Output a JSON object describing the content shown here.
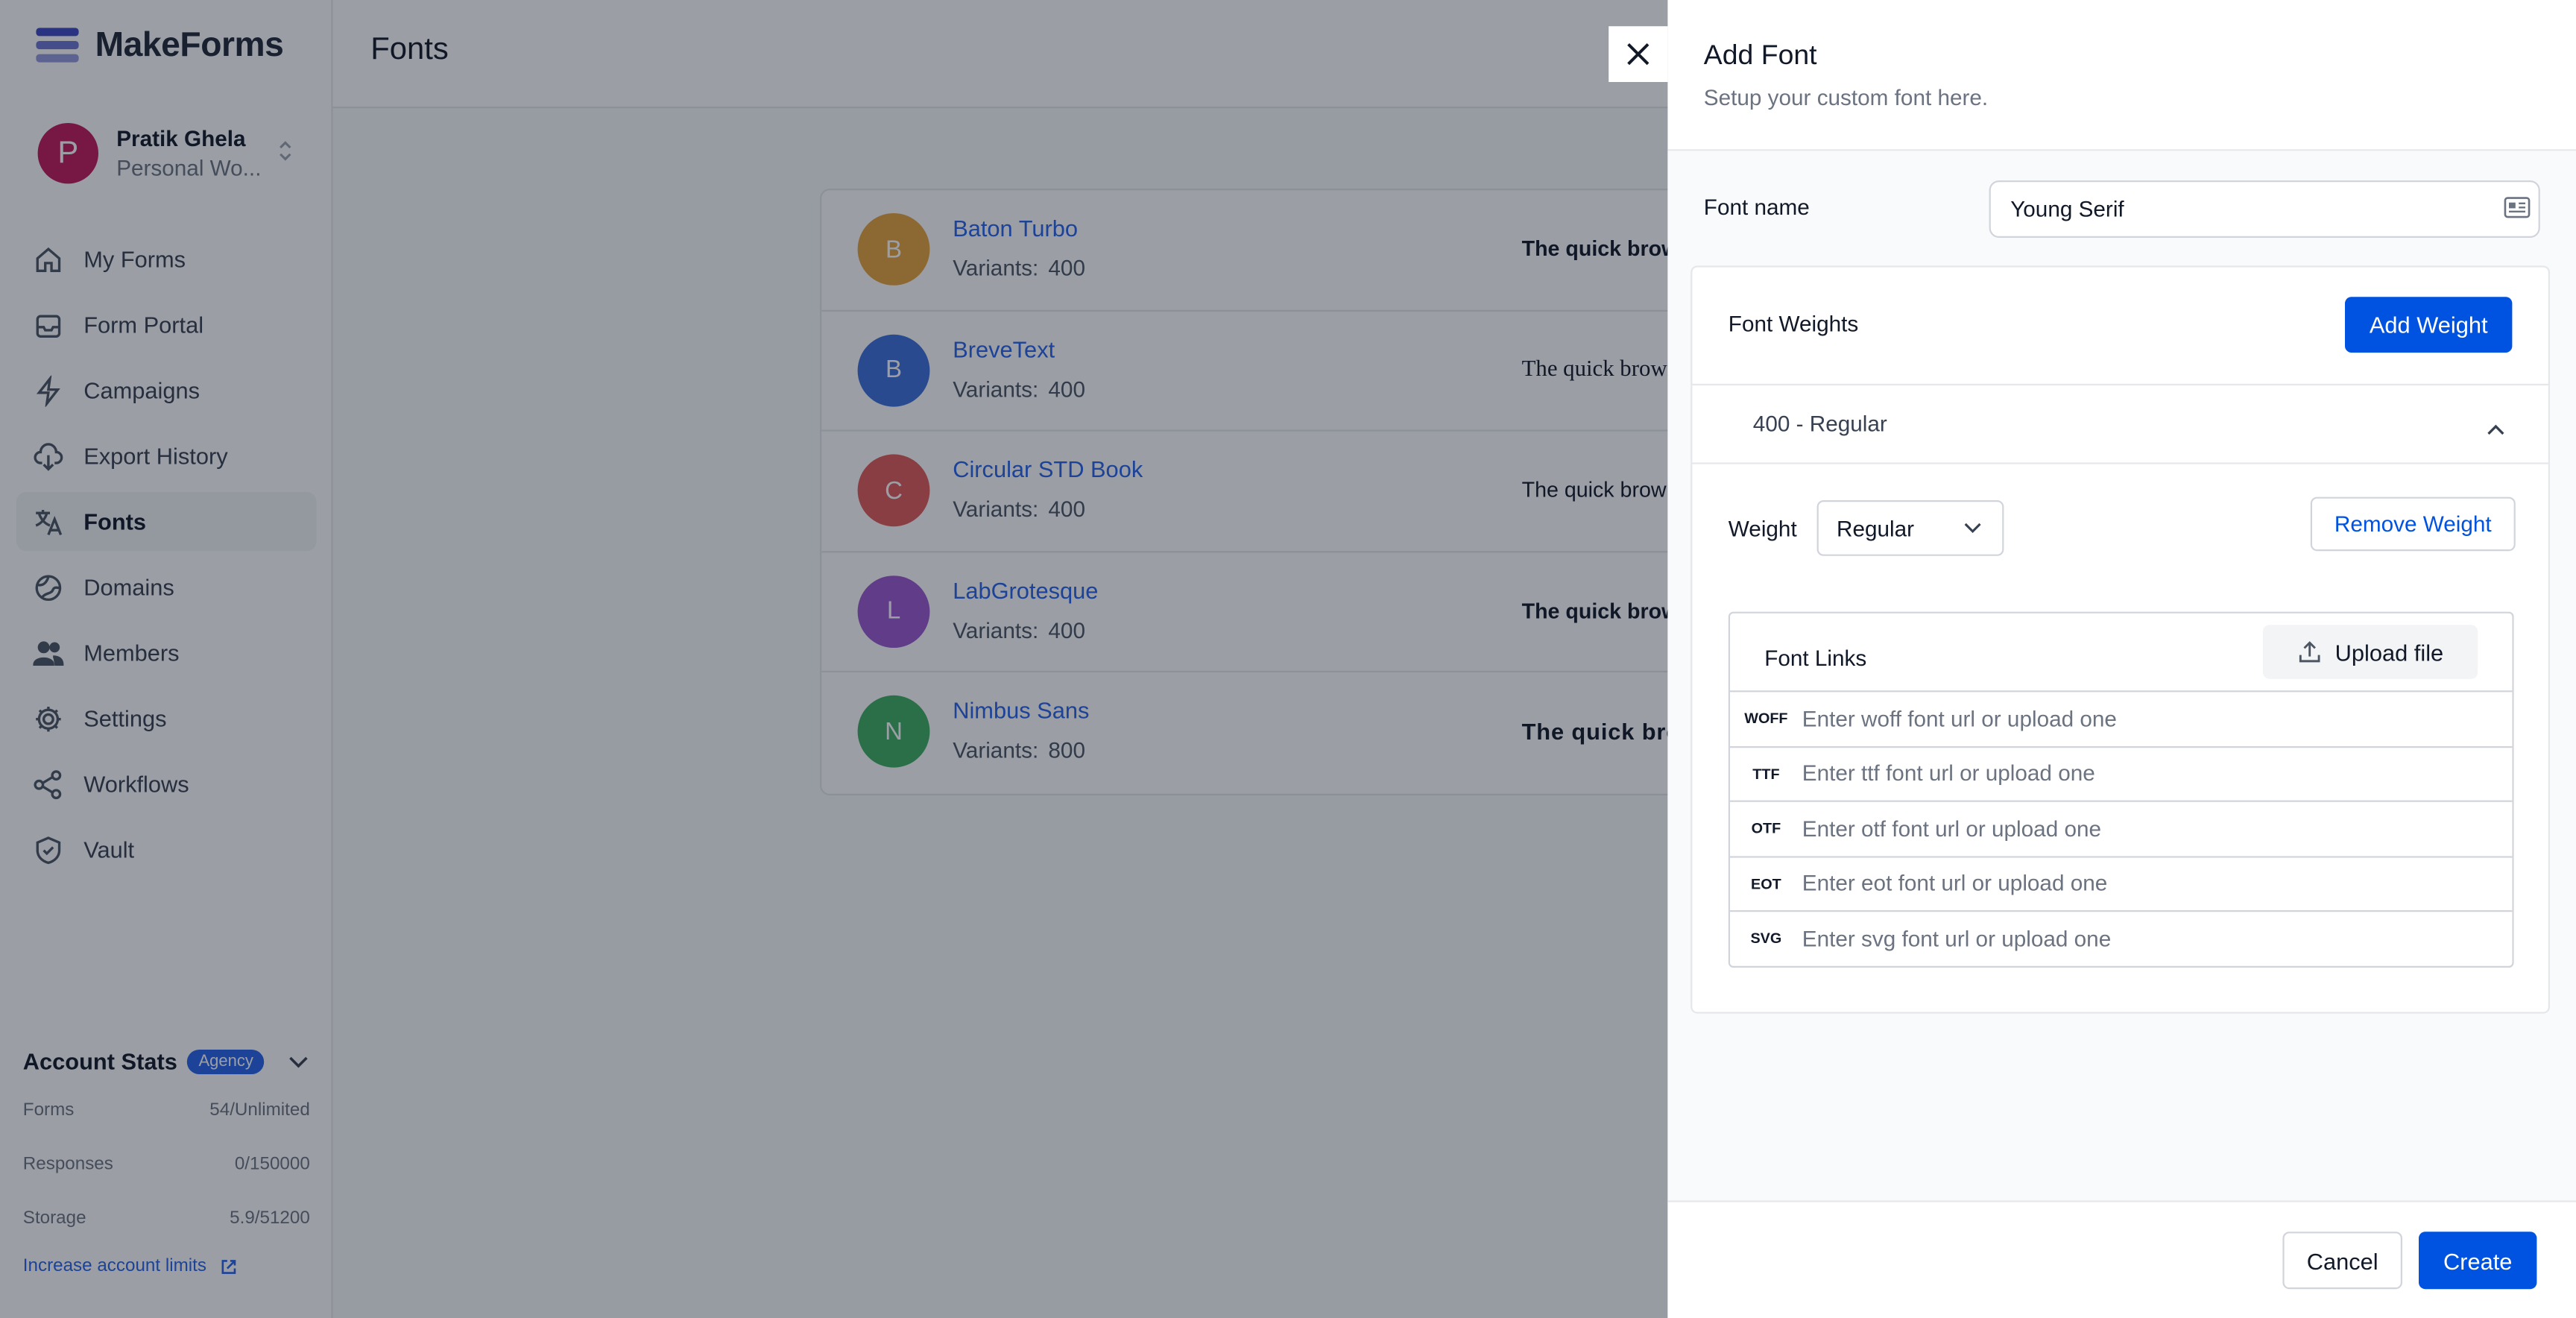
{
  "app": {
    "name": "MakeForms"
  },
  "user": {
    "initial": "P",
    "name": "Pratik Ghela",
    "workspace": "Personal Wo..."
  },
  "nav": [
    {
      "label": "My Forms",
      "icon": "home-icon"
    },
    {
      "label": "Form Portal",
      "icon": "inbox-icon"
    },
    {
      "label": "Campaigns",
      "icon": "lightning-icon"
    },
    {
      "label": "Export History",
      "icon": "cloud-download-icon"
    },
    {
      "label": "Fonts",
      "icon": "translate-icon",
      "active": true
    },
    {
      "label": "Domains",
      "icon": "globe-icon"
    },
    {
      "label": "Members",
      "icon": "users-icon"
    },
    {
      "label": "Settings",
      "icon": "gear-icon"
    },
    {
      "label": "Workflows",
      "icon": "share-icon"
    },
    {
      "label": "Vault",
      "icon": "shield-icon"
    }
  ],
  "stats": {
    "title": "Account Stats",
    "badge": "Agency",
    "rows": [
      {
        "label": "Forms",
        "value": "54/Unlimited"
      },
      {
        "label": "Responses",
        "value": "0/150000"
      },
      {
        "label": "Storage",
        "value": "5.9/51200"
      }
    ],
    "increase_link": "Increase account limits"
  },
  "page": {
    "title": "Fonts"
  },
  "fonts": [
    {
      "initial": "B",
      "name": "Baton Turbo",
      "variants_label": "Variants:",
      "variants": "400",
      "sample": "The quick brow",
      "color": "#e6a23c"
    },
    {
      "initial": "B",
      "name": "BreveText",
      "variants_label": "Variants:",
      "variants": "400",
      "sample": "The quick brown",
      "color": "#3b6fd9"
    },
    {
      "initial": "C",
      "name": "Circular STD Book",
      "variants_label": "Variants:",
      "variants": "400",
      "sample": "The quick brow",
      "color": "#e05a5a"
    },
    {
      "initial": "L",
      "name": "LabGrotesque",
      "variants_label": "Variants:",
      "variants": "400",
      "sample": "The quick brow",
      "color": "#9b59d0"
    },
    {
      "initial": "N",
      "name": "Nimbus Sans",
      "variants_label": "Variants:",
      "variants": "800",
      "sample": "The quick bro",
      "color": "#3fae63"
    }
  ],
  "drawer": {
    "title": "Add Font",
    "subtitle": "Setup your custom font here.",
    "font_name_label": "Font name",
    "font_name_value": "Young Serif",
    "weights_title": "Font Weights",
    "add_weight_label": "Add Weight",
    "accordion_title": "400 - Regular",
    "weight_label": "Weight",
    "weight_value": "Regular",
    "remove_weight_label": "Remove Weight",
    "links_title": "Font Links",
    "upload_label": "Upload file",
    "links": [
      {
        "tag": "WOFF",
        "placeholder": "Enter woff font url or upload one"
      },
      {
        "tag": "TTF",
        "placeholder": "Enter ttf font url or upload one"
      },
      {
        "tag": "OTF",
        "placeholder": "Enter otf font url or upload one"
      },
      {
        "tag": "EOT",
        "placeholder": "Enter eot font url or upload one"
      },
      {
        "tag": "SVG",
        "placeholder": "Enter svg font url or upload one"
      }
    ],
    "cancel_label": "Cancel",
    "create_label": "Create"
  },
  "colors": {
    "accent": "#0052e0",
    "overlay": "rgba(17,24,39,0.42)"
  }
}
